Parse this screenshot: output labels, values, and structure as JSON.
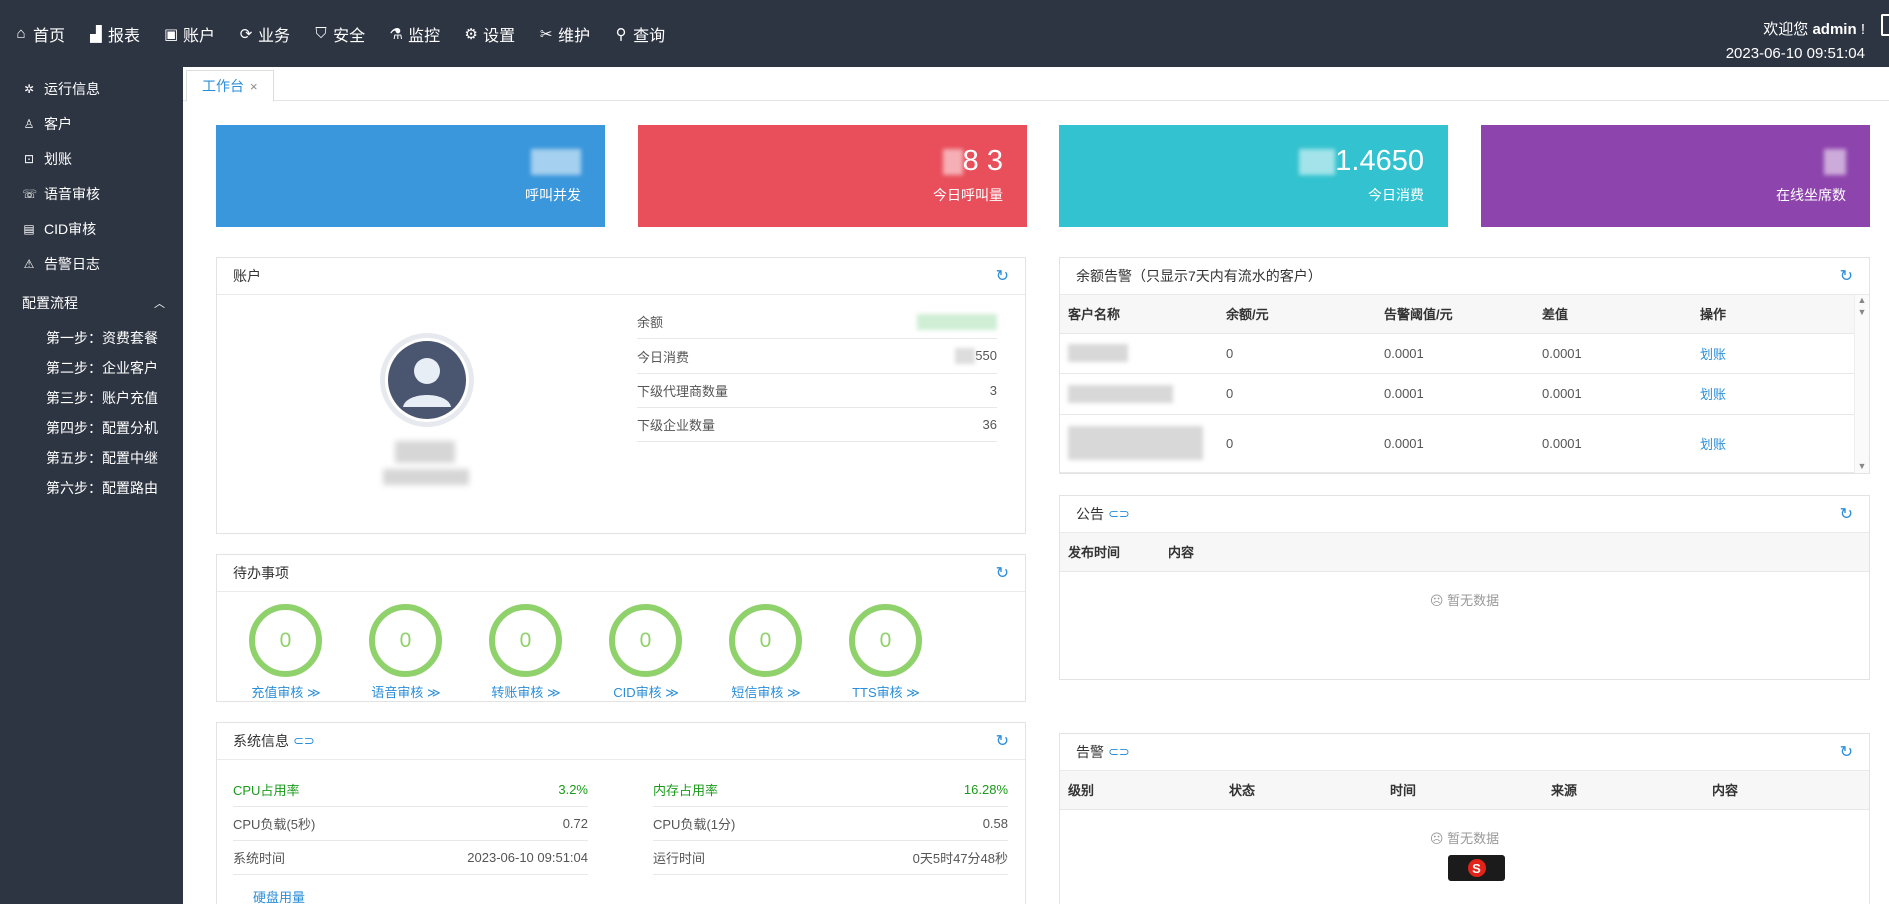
{
  "nav": {
    "items": [
      {
        "icon": "home-icon",
        "label": "首页"
      },
      {
        "icon": "chart-icon",
        "label": "报表"
      },
      {
        "icon": "account-icon",
        "label": "账户"
      },
      {
        "icon": "business-icon",
        "label": "业务"
      },
      {
        "icon": "shield-icon",
        "label": "安全"
      },
      {
        "icon": "monitor-icon",
        "label": "监控"
      },
      {
        "icon": "gear-icon",
        "label": "设置"
      },
      {
        "icon": "tools-icon",
        "label": "维护"
      },
      {
        "icon": "search-icon",
        "label": "查询"
      }
    ],
    "welcome_prefix": "欢迎您",
    "user": "admin",
    "welcome_suffix": "!",
    "datetime": "2023-06-10 09:51:04"
  },
  "sidebar": {
    "items": [
      {
        "icon": "gear-icon",
        "label": "运行信息"
      },
      {
        "icon": "user-icon",
        "label": "客户"
      },
      {
        "icon": "transfer-icon",
        "label": "划账"
      },
      {
        "icon": "voice-icon",
        "label": "语音审核"
      },
      {
        "icon": "document-icon",
        "label": "CID审核"
      },
      {
        "icon": "warning-icon",
        "label": "告警日志"
      }
    ],
    "group": {
      "label": "配置流程",
      "icon": "chevron-up-icon"
    },
    "steps": [
      "第一步：资费套餐",
      "第二步：企业客户",
      "第三步：账户充值",
      "第四步：配置分机",
      "第五步：配置中继",
      "第六步：配置路由"
    ]
  },
  "tabs": [
    {
      "label": "工作台",
      "close": "×"
    }
  ],
  "stats": [
    {
      "value_visible": "",
      "label": "呼叫并发",
      "color": "#3a97dc"
    },
    {
      "value_visible": "8 3",
      "label": "今日呼叫量",
      "color": "#e94e5b"
    },
    {
      "value_visible": "1.4650",
      "label": "今日消费",
      "color": "#33c2cf"
    },
    {
      "value_visible": "",
      "label": "在线坐席数",
      "color": "#8e44ad"
    }
  ],
  "account": {
    "title": "账户",
    "rows": [
      {
        "label": "余额",
        "value": ""
      },
      {
        "label": "今日消费",
        "value": "550"
      },
      {
        "label": "下级代理商数量",
        "value": "3"
      },
      {
        "label": "下级企业数量",
        "value": "36"
      }
    ]
  },
  "todo": {
    "title": "待办事项",
    "items": [
      {
        "count": "0",
        "label": "充值审核 ≫"
      },
      {
        "count": "0",
        "label": "语音审核 ≫"
      },
      {
        "count": "0",
        "label": "转账审核 ≫"
      },
      {
        "count": "0",
        "label": "CID审核 ≫"
      },
      {
        "count": "0",
        "label": "短信审核 ≫"
      },
      {
        "count": "0",
        "label": "TTS审核 ≫"
      }
    ]
  },
  "sysinfo": {
    "title": "系统信息",
    "left": [
      {
        "label": "CPU占用率",
        "value": "3.2%",
        "highlight": true
      },
      {
        "label": "CPU负载(5秒)",
        "value": "0.72",
        "highlight": false
      },
      {
        "label": "系统时间",
        "value": "2023-06-10 09:51:04",
        "highlight": false
      }
    ],
    "right": [
      {
        "label": "内存占用率",
        "value": "16.28%",
        "highlight": true
      },
      {
        "label": "CPU负载(1分)",
        "value": "0.58",
        "highlight": false
      },
      {
        "label": "运行时间",
        "value": "0天5时47分48秒",
        "highlight": false
      }
    ],
    "disk_label": "硬盘用量"
  },
  "balance_alert": {
    "title": "余额告警（只显示7天内有流水的客户）",
    "columns": [
      "客户名称",
      "余额/元",
      "告警阈值/元",
      "差值",
      "操作"
    ],
    "rows": [
      {
        "name": "",
        "balance": "0",
        "threshold": "0.0001",
        "diff": "0.0001",
        "action": "划账"
      },
      {
        "name": "",
        "balance": "0",
        "threshold": "0.0001",
        "diff": "0.0001",
        "action": "划账"
      },
      {
        "name": "",
        "balance": "0",
        "threshold": "0.0001",
        "diff": "0.0001",
        "action": "划账"
      }
    ]
  },
  "notice": {
    "title": "公告",
    "columns": [
      "发布时间",
      "内容"
    ],
    "empty": "暂无数据"
  },
  "alarm": {
    "title": "告警",
    "columns": [
      "级别",
      "状态",
      "时间",
      "来源",
      "内容"
    ],
    "empty": "暂无数据"
  },
  "colors": {
    "nav_bg": "#2e3542",
    "accent": "#2b8ed8",
    "ok_green": "#8fd16a",
    "highlight_green": "#1a9a1a"
  }
}
